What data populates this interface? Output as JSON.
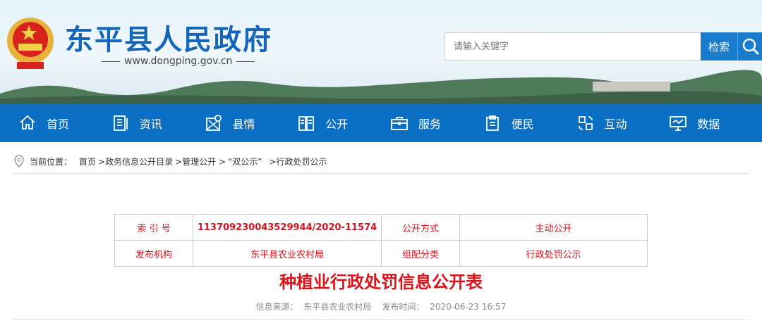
{
  "header": {
    "site_title": "东平县人民政府",
    "site_url": "www.dongping.gov.cn",
    "search_placeholder": "请输入关键字",
    "search_button": "检索"
  },
  "nav": [
    {
      "label": "首页",
      "icon": "home-icon"
    },
    {
      "label": "资讯",
      "icon": "news-icon"
    },
    {
      "label": "县情",
      "icon": "map-icon"
    },
    {
      "label": "公开",
      "icon": "book-icon"
    },
    {
      "label": "服务",
      "icon": "briefcase-icon"
    },
    {
      "label": "便民",
      "icon": "clipboard-icon"
    },
    {
      "label": "互动",
      "icon": "interact-icon"
    },
    {
      "label": "数据",
      "icon": "monitor-icon"
    }
  ],
  "breadcrumb": {
    "prefix": "当前位置：",
    "items": [
      "首页",
      ">政务信息公开目录",
      ">管理公开 >",
      "“双公示”",
      ">行政处罚公示"
    ]
  },
  "info_table": {
    "rows": [
      [
        "索 引 号",
        "11370923004352994​4/2020-11574",
        "公开方式",
        "主动公开"
      ],
      [
        "发布机构",
        "东平县农业农村局",
        "组配分类",
        "行政处罚公示"
      ]
    ]
  },
  "article": {
    "title": "种植业行政处罚信息公开表",
    "meta": "信息来源：  东平县农业农村局    发布时间：  2020-06-23 16:57"
  },
  "colors": {
    "nav": "#0a6fc2",
    "accent_red": "#d9141a"
  }
}
